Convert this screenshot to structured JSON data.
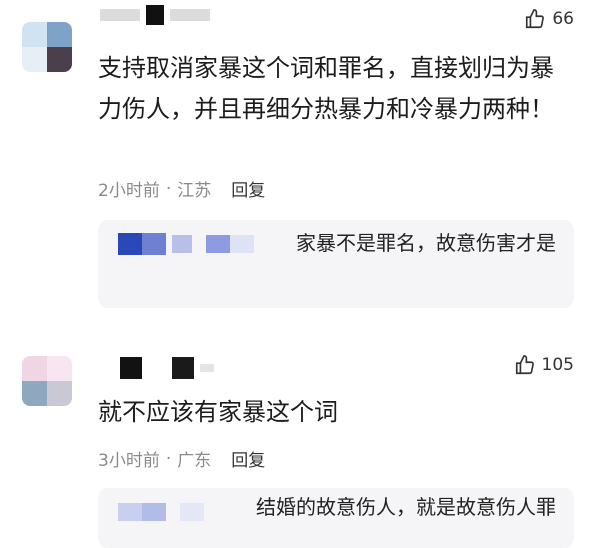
{
  "comments": [
    {
      "likes": "66",
      "text": "支持取消家暴这个词和罪名，直接划归为暴力伤人，并且再细分热暴力和冷暴力两种！",
      "time": "2小时前",
      "location": "江苏",
      "reply_label": "回复",
      "reply": {
        "text": "家暴不是罪名，故意伤害才是"
      }
    },
    {
      "likes": "105",
      "text": "就不应该有家暴这个词",
      "time": "3小时前",
      "location": "广东",
      "reply_label": "回复",
      "reply": {
        "text": "结婚的故意伤人，就是故意伤人罪"
      }
    }
  ],
  "separator": "·",
  "icons": {
    "like": "thumbs-up-icon"
  },
  "colors": {
    "meta": "#8a8a8a",
    "reply_bg": "#f5f5f7",
    "text": "#1c1c1c"
  }
}
